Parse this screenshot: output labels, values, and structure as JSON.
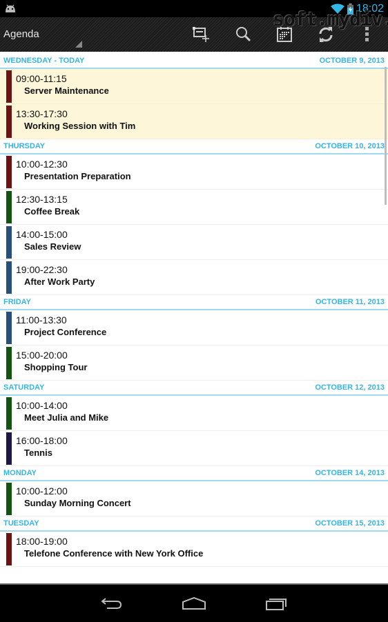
{
  "status_bar": {
    "time": "18:02",
    "icons": [
      "android-notification-icon",
      "wifi-icon",
      "battery-charging-icon"
    ]
  },
  "watermark": "soft.mydiv.net",
  "action_bar": {
    "view_selector": "Agenda",
    "actions": [
      {
        "name": "new-event",
        "icon": "new-event-icon"
      },
      {
        "name": "search",
        "icon": "search-icon"
      },
      {
        "name": "go-to-date",
        "icon": "calendar-icon"
      },
      {
        "name": "refresh",
        "icon": "refresh-icon"
      },
      {
        "name": "overflow-menu",
        "icon": "overflow-menu-icon"
      }
    ]
  },
  "colors": {
    "accent": "#33b5e5",
    "today_background": "#fdf6d9",
    "category_red": "#6b1414",
    "category_green": "#125512",
    "category_blue": "#27507a",
    "category_navy": "#1f1847"
  },
  "agenda": [
    {
      "day": "WEDNESDAY - TODAY",
      "date": "OCTOBER 9, 2013",
      "today": true,
      "events": [
        {
          "time": "09:00-11:15",
          "title": "Server Maintenance",
          "color": "#6b1414"
        },
        {
          "time": "13:30-17:30",
          "title": "Working Session with Tim",
          "color": "#6b1414"
        }
      ]
    },
    {
      "day": "THURSDAY",
      "date": "OCTOBER 10, 2013",
      "today": false,
      "events": [
        {
          "time": "10:00-12:30",
          "title": "Presentation Preparation",
          "color": "#6b1414"
        },
        {
          "time": "12:30-13:15",
          "title": "Coffee Break",
          "color": "#125512"
        },
        {
          "time": "14:00-15:00",
          "title": "Sales Review",
          "color": "#27507a"
        },
        {
          "time": "19:00-22:30",
          "title": "After Work Party",
          "color": "#27507a"
        }
      ]
    },
    {
      "day": "FRIDAY",
      "date": "OCTOBER 11, 2013",
      "today": false,
      "events": [
        {
          "time": "11:00-13:30",
          "title": "Project Conference",
          "color": "#27507a"
        },
        {
          "time": "15:00-20:00",
          "title": "Shopping Tour",
          "color": "#125512"
        }
      ]
    },
    {
      "day": "SATURDAY",
      "date": "OCTOBER 12, 2013",
      "today": false,
      "events": [
        {
          "time": "10:00-14:00",
          "title": "Meet Julia and Mike",
          "color": "#125512"
        },
        {
          "time": "16:00-18:00",
          "title": "Tennis",
          "color": "#1f1847"
        }
      ]
    },
    {
      "day": "MONDAY",
      "date": "OCTOBER 14, 2013",
      "today": false,
      "events": [
        {
          "time": "10:00-12:00",
          "title": "Sunday Morning Concert",
          "color": "#125512"
        }
      ]
    },
    {
      "day": "TUESDAY",
      "date": "OCTOBER 15, 2013",
      "today": false,
      "events": [
        {
          "time": "18:00-19:00",
          "title": "Telefone Conference with New York Office",
          "color": "#6b1414"
        }
      ]
    }
  ],
  "nav_bar": {
    "buttons": [
      "back",
      "home",
      "recent-apps"
    ]
  }
}
